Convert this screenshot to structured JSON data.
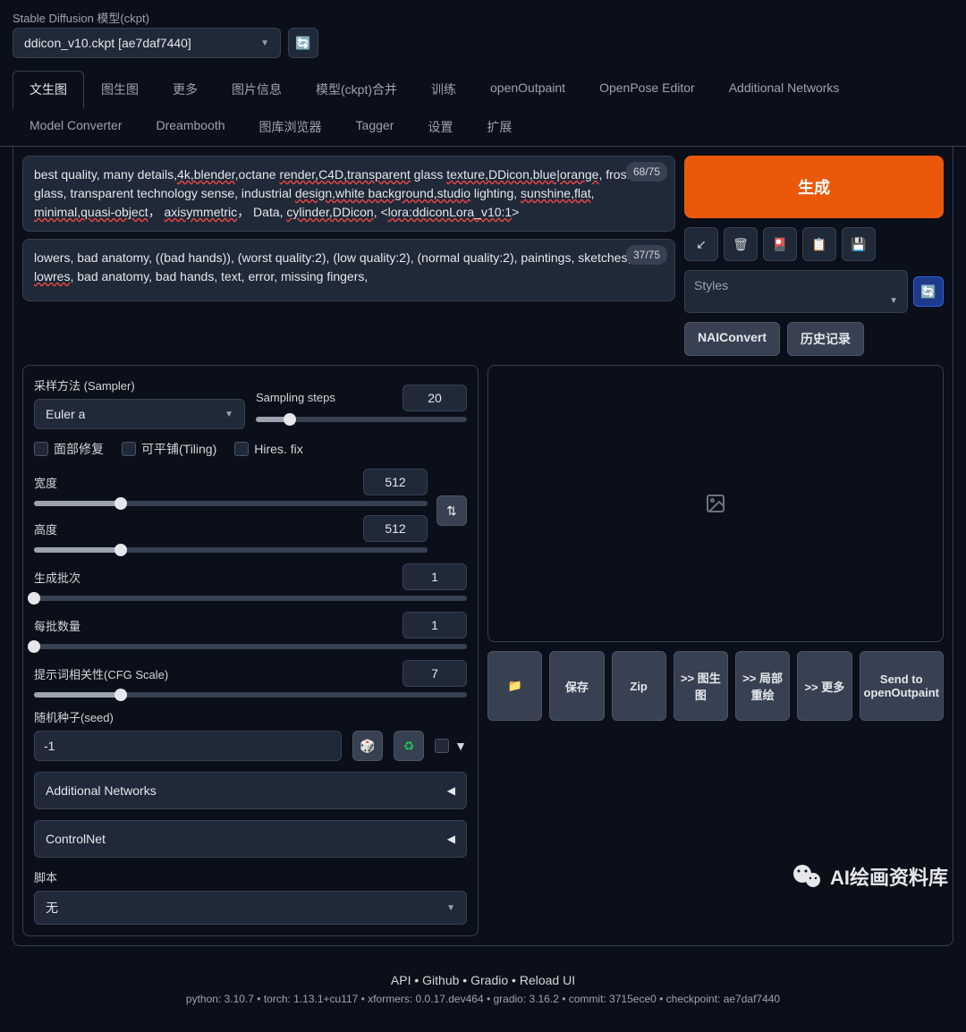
{
  "model": {
    "label": "Stable Diffusion 模型(ckpt)",
    "value": "ddicon_v10.ckpt [ae7daf7440]"
  },
  "tabs": [
    "文生图",
    "图生图",
    "更多",
    "图片信息",
    "模型(ckpt)合并",
    "训练",
    "openOutpaint",
    "OpenPose Editor",
    "Additional Networks",
    "Model Converter",
    "Dreambooth",
    "图库浏览器",
    "Tagger",
    "设置",
    "扩展"
  ],
  "active_tab": 0,
  "prompt": {
    "text_plain": "best quality, many details,",
    "spell1": "4k,blender",
    "text2": ",octane ",
    "spell2": "render,C4D,transparent",
    "text3": " glass ",
    "spell3": "texture,DDicon,blue|orange",
    "text4": ", frosted glass, transparent technology sense, industrial ",
    "spell4": "design,white background,studio",
    "text5": " lighting, ",
    "spell5": "sunshine,flat",
    "text6": ", ",
    "spell6": "minimal,quasi-object",
    "text7": "， ",
    "spell7": "axisymmetric",
    "text8": "， Data, ",
    "spell8": "cylinder,DDicon",
    "text9": ", <",
    "spell9": "lora:ddiconLora_v10:1",
    "text10": ">",
    "tokens": "68/75"
  },
  "neg_prompt": {
    "text1": "lowers, bad anatomy, ((bad hands)), (worst quality:2), (low quality:2), (normal quality:2), paintings, sketches, ",
    "spell1": "lowres",
    "text2": ", bad anatomy, bad hands, text, error, missing fingers,",
    "tokens": "37/75"
  },
  "generate_label": "生成",
  "styles_label": "Styles",
  "nai_label": "NAIConvert",
  "history_label": "历史记录",
  "sampler": {
    "label": "采样方法 (Sampler)",
    "value": "Euler a"
  },
  "steps": {
    "label": "Sampling steps",
    "value": "20",
    "pct": 16
  },
  "checkboxes": {
    "face": "面部修复",
    "tiling": "可平铺(Tiling)",
    "hires": "Hires. fix"
  },
  "width": {
    "label": "宽度",
    "value": "512",
    "pct": 22
  },
  "height": {
    "label": "高度",
    "value": "512",
    "pct": 22
  },
  "batch_count": {
    "label": "生成批次",
    "value": "1",
    "pct": 0
  },
  "batch_size": {
    "label": "每批数量",
    "value": "1",
    "pct": 0
  },
  "cfg": {
    "label": "提示词相关性(CFG Scale)",
    "value": "7",
    "pct": 20
  },
  "seed": {
    "label": "随机种子(seed)",
    "value": "-1"
  },
  "accordion": {
    "addnet": "Additional Networks",
    "controlnet": "ControlNet"
  },
  "script": {
    "label": "脚本",
    "value": "无"
  },
  "out_buttons": {
    "folder": "📁",
    "save": "保存",
    "zip": "Zip",
    "img2img": ">> 图生图",
    "inpaint": ">> 局部重绘",
    "more": ">> 更多",
    "outpaint": "Send to openOutpaint"
  },
  "footer": {
    "api": "API",
    "github": "Github",
    "gradio": "Gradio",
    "reload": "Reload UI",
    "meta": "python: 3.10.7   •   torch: 1.13.1+cu117   •   xformers: 0.0.17.dev464   •   gradio: 3.16.2   •   commit: 3715ece0   •   checkpoint: ae7daf7440"
  },
  "watermark": "AI绘画资料库"
}
